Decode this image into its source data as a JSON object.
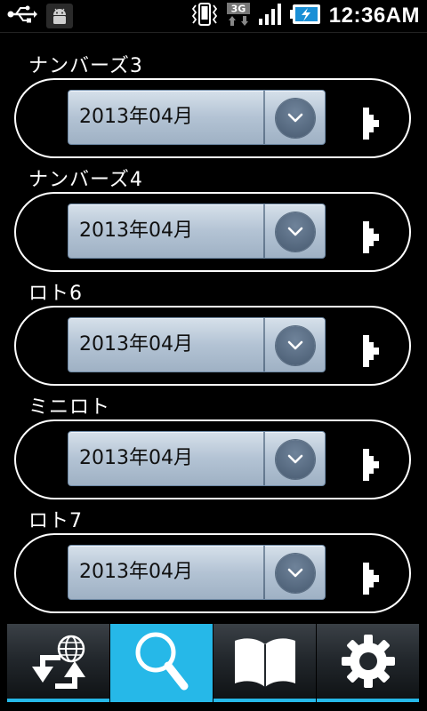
{
  "status_bar": {
    "time": "12:36AM",
    "icons": [
      "usb-icon",
      "android-debug-icon",
      "vibrate-icon",
      "3g-data-icon",
      "signal-icon",
      "battery-charging-icon"
    ]
  },
  "sections": [
    {
      "label": "ナンバーズ3",
      "selected": "2013年04月"
    },
    {
      "label": "ナンバーズ4",
      "selected": "2013年04月"
    },
    {
      "label": "ロト6",
      "selected": "2013年04月"
    },
    {
      "label": "ミニロト",
      "selected": "2013年04月"
    },
    {
      "label": "ロト7",
      "selected": "2013年04月"
    }
  ],
  "tabs": [
    {
      "icon": "globe-sync-icon",
      "active": false
    },
    {
      "icon": "search-icon",
      "active": true
    },
    {
      "icon": "book-icon",
      "active": false
    },
    {
      "icon": "gear-icon",
      "active": false
    }
  ],
  "colors": {
    "accent": "#26b8e8",
    "background": "#000000",
    "spinner": "#b3c3d4"
  }
}
